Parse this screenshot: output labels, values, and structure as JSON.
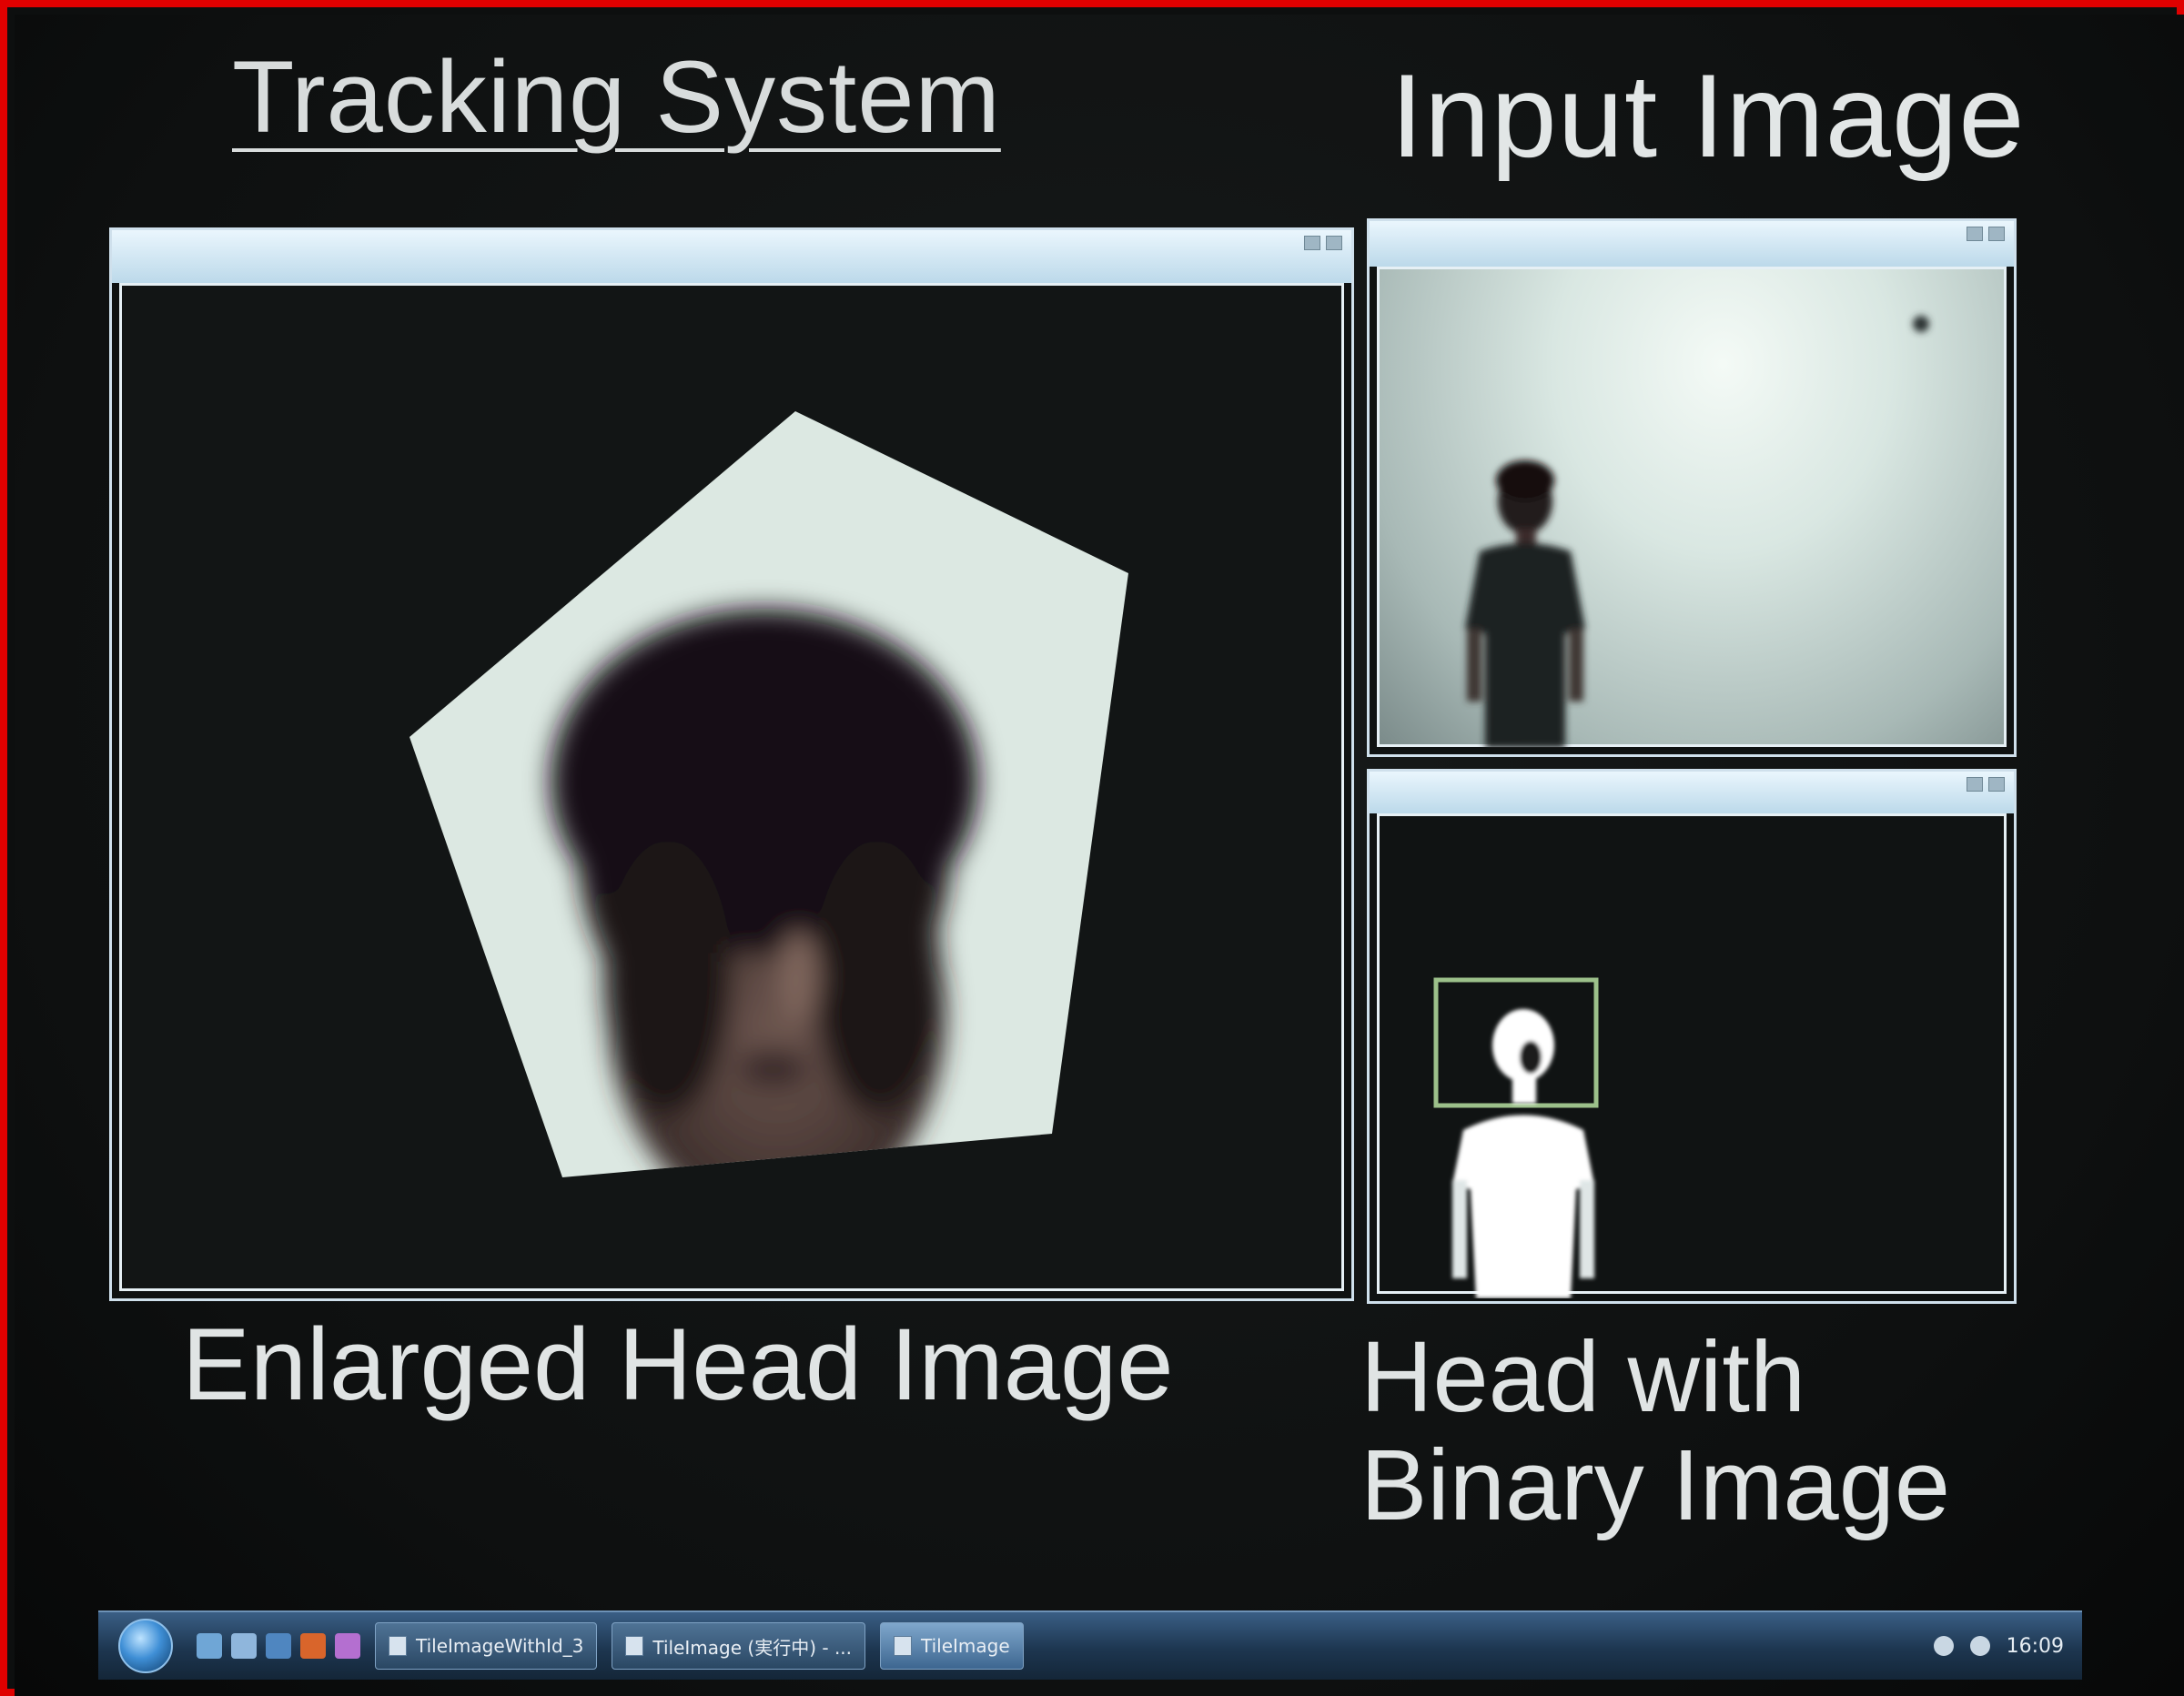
{
  "slide": {
    "tracking_title": "Tracking System",
    "input_title": "Input Image",
    "enlarged_label": "Enlarged Head Image",
    "binary_label_line1": "Head with",
    "binary_label_line2": "Binary Image"
  },
  "windows": {
    "main": {
      "caption": ""
    },
    "input": {
      "caption": ""
    },
    "binary": {
      "caption": ""
    }
  },
  "taskbar": {
    "tasks": [
      {
        "label": "TileImageWithId_3",
        "icon": "window-icon"
      },
      {
        "label": "TileImage (実行中) - ...",
        "icon": "window-icon"
      },
      {
        "label": "TileImage",
        "icon": "window-icon",
        "active": true
      }
    ],
    "clock": "16:09"
  },
  "colors": {
    "frame": "#e00000",
    "background": "#0d0f0f",
    "text": "#e0e4e4",
    "head_box": "#9cc08a"
  }
}
